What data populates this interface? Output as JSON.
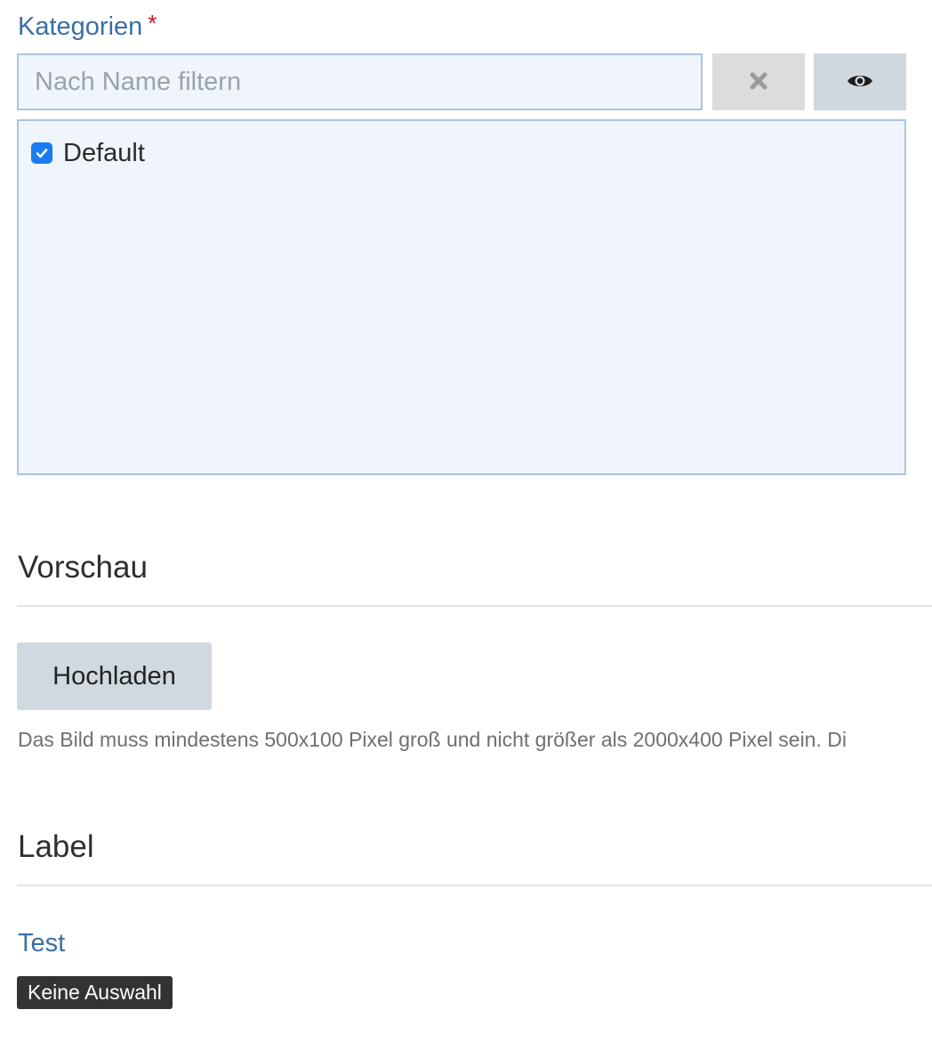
{
  "categories": {
    "label": "Kategorien",
    "required_marker": "*",
    "filter": {
      "value": "",
      "placeholder": "Nach Name filtern"
    },
    "clear_icon": "close-icon",
    "view_icon": "eye-icon",
    "items": [
      {
        "label": "Default",
        "checked": true
      }
    ]
  },
  "preview": {
    "title": "Vorschau",
    "upload_label": "Hochladen",
    "help_text": "Das Bild muss mindestens 500x100 Pixel groß und nicht größer als 2000x400 Pixel sein. Di"
  },
  "label_section": {
    "title": "Label",
    "field_label": "Test",
    "badge": "Keine Auswahl"
  },
  "colors": {
    "accent": "#3a6ea5",
    "required": "#c0161b",
    "checkbox": "#1a7cf0",
    "badge_bg": "#333333"
  }
}
